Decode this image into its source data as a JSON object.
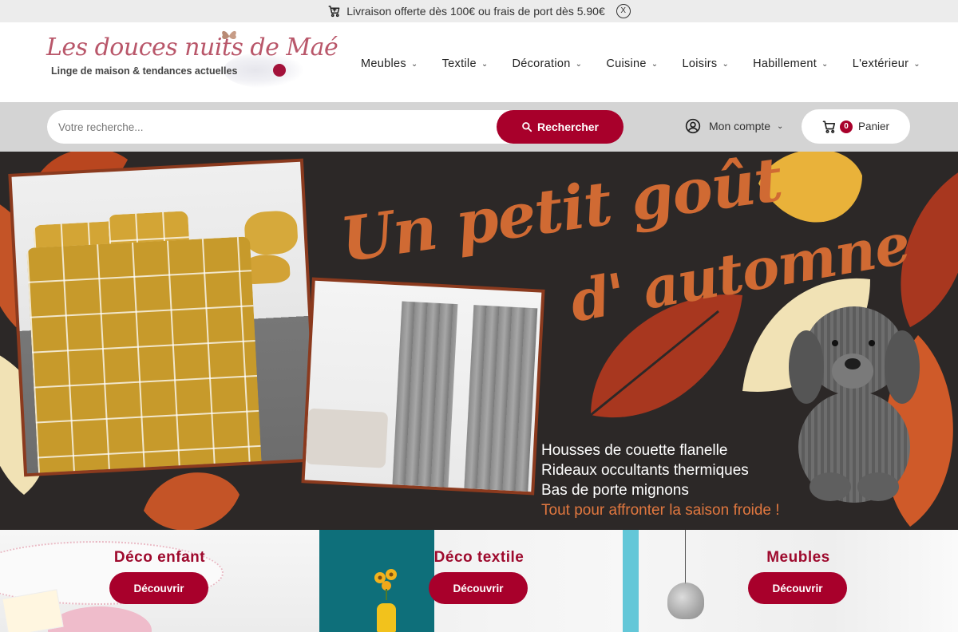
{
  "topbar": {
    "message": "Livraison offerte dès 100€ ou frais de port dès 5.90€",
    "close_label": "X"
  },
  "logo": {
    "title": "Les douces nuits de Maé",
    "subtitle": "Linge de maison & tendances actuelles"
  },
  "nav": {
    "items": [
      {
        "label": "Meubles"
      },
      {
        "label": "Textile"
      },
      {
        "label": "Décoration"
      },
      {
        "label": "Cuisine"
      },
      {
        "label": "Loisirs"
      },
      {
        "label": "Habillement"
      },
      {
        "label": "L'extérieur"
      }
    ]
  },
  "search": {
    "placeholder": "Votre recherche...",
    "button_label": "Rechercher"
  },
  "account": {
    "label": "Mon compte"
  },
  "cart": {
    "count": "0",
    "label": "Panier"
  },
  "hero": {
    "title_line1": "Un petit goût",
    "title_line2": "d' automne",
    "lines": [
      "Housses de couette flanelle",
      "Rideaux occultants thermiques",
      "Bas de porte mignons"
    ],
    "accent_line": "Tout pour affronter la saison froide !"
  },
  "categories": [
    {
      "title": "Déco enfant",
      "button": "Découvrir"
    },
    {
      "title": "Déco textile",
      "button": "Découvrir"
    },
    {
      "title": "Meubles",
      "button": "Découvrir"
    }
  ],
  "colors": {
    "brand": "#a8002b",
    "hero_bg": "#2c2827",
    "hero_accent": "#d06a33"
  },
  "icons": [
    "cart-icon",
    "close-icon",
    "chevron-down-icon",
    "search-icon",
    "user-icon"
  ]
}
